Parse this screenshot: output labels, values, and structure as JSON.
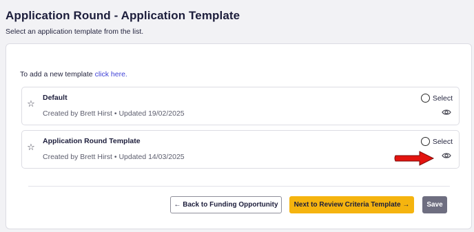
{
  "page": {
    "title": "Application Round - Application Template",
    "subtitle": "Select an application template from the list."
  },
  "add_template": {
    "prefix": "To add a new template ",
    "link_text": "click here."
  },
  "templates": [
    {
      "name": "Default",
      "meta": "Created by Brett Hirst • Updated 19/02/2025",
      "select_label": "Select",
      "selected": false,
      "star_icon": "star-outline-icon",
      "view_icon": "eye-icon"
    },
    {
      "name": "Application Round Template",
      "meta": "Created by Brett Hirst • Updated 14/03/2025",
      "select_label": "Select",
      "selected": false,
      "star_icon": "star-outline-icon",
      "view_icon": "eye-icon"
    }
  ],
  "annotation": {
    "icon": "red-arrow-pointer-icon",
    "color": "#e3140f"
  },
  "actions": {
    "back_label": "← Back to Funding Opportunity",
    "next_label": "Next to Review Criteria Template →",
    "save_label": "Save"
  },
  "colors": {
    "accent_link": "#3d3fd6",
    "primary_button": "#f5b40f",
    "save_button": "#6e6e80",
    "title": "#1c1d3b"
  }
}
